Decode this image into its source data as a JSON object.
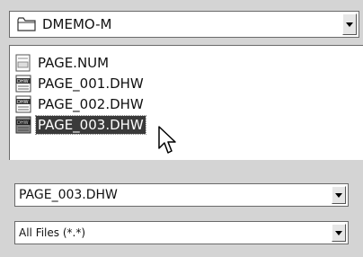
{
  "drive_select": {
    "value": "DMEMO-M",
    "icon": "folder-icon"
  },
  "file_list": {
    "items": [
      {
        "label": "PAGE.NUM",
        "icon": "num-file-icon",
        "selected": false
      },
      {
        "label": "PAGE_001.DHW",
        "icon": "dhw-file-icon",
        "selected": false
      },
      {
        "label": "PAGE_002.DHW",
        "icon": "dhw-file-icon",
        "selected": false
      },
      {
        "label": "PAGE_003.DHW",
        "icon": "dhw-file-icon",
        "selected": true
      }
    ]
  },
  "file_name_select": {
    "value": "PAGE_003.DHW"
  },
  "file_type_select": {
    "value": "All Files (*.*)"
  }
}
